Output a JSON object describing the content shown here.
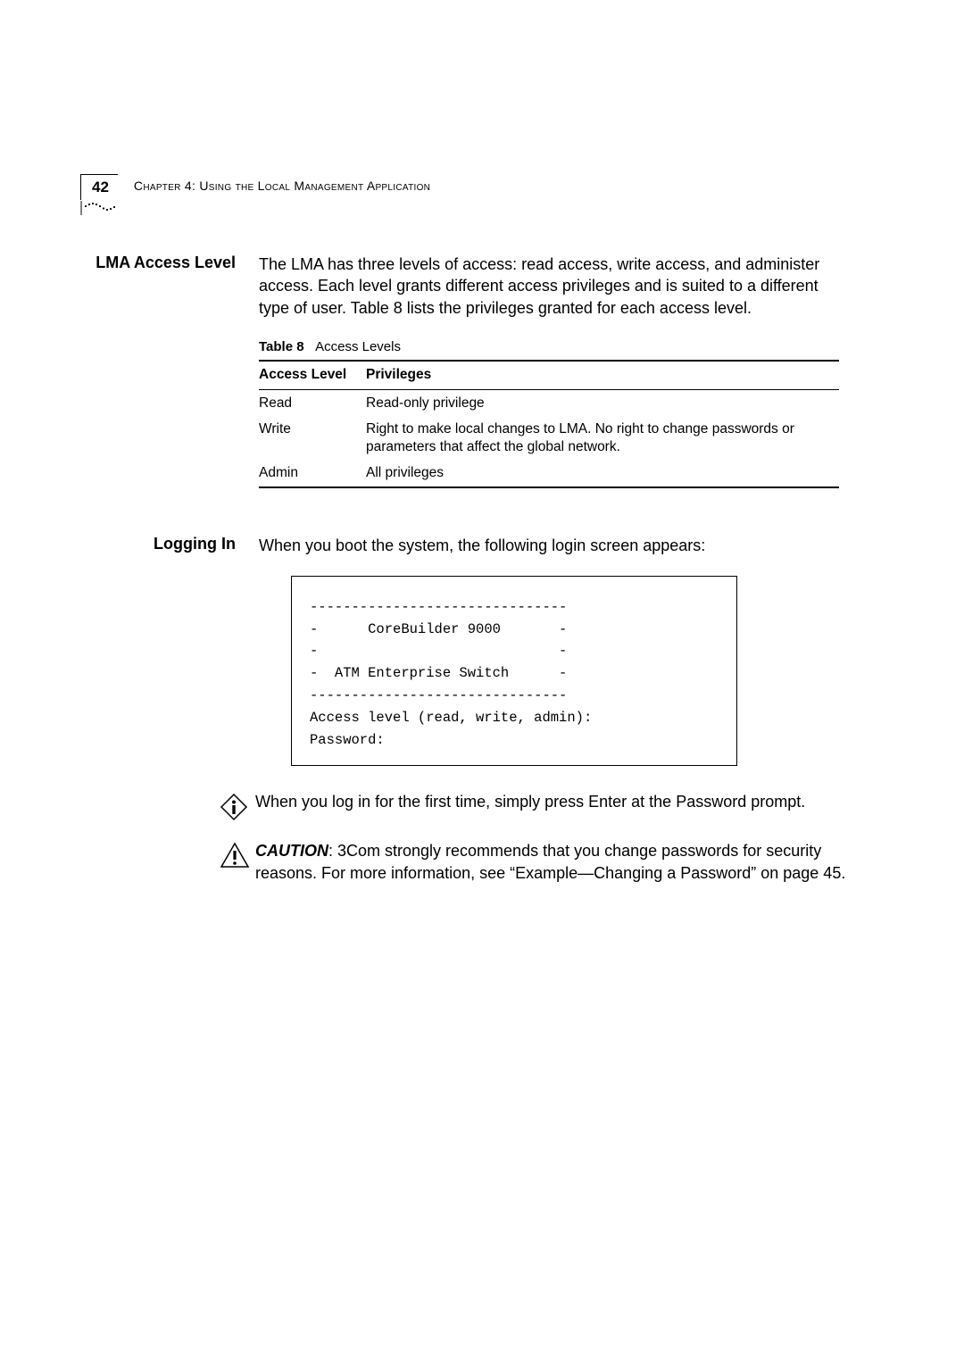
{
  "header": {
    "page_number": "42",
    "chapter_title": "Chapter 4: Using the Local Management Application"
  },
  "section_access": {
    "label": "LMA Access Level",
    "paragraph": "The LMA has three levels of access: read access, write access, and administer access. Each level grants different access privileges and is suited to a different type of user. Table 8 lists the privileges granted for each access level.",
    "table_caption_label": "Table 8",
    "table_caption_text": "Access Levels",
    "table": {
      "headers": {
        "col1": "Access Level",
        "col2": "Privileges"
      },
      "rows": [
        {
          "level": "Read",
          "priv": "Read-only privilege"
        },
        {
          "level": "Write",
          "priv": "Right to make local changes to LMA. No right to change passwords or parameters that affect the global network."
        },
        {
          "level": "Admin",
          "priv": "All privileges"
        }
      ]
    }
  },
  "section_logging": {
    "label": "Logging In",
    "paragraph": "When you boot the system, the following login screen appears:",
    "code": "-------------------------------\n-      CoreBuilder 9000       -\n-                             -\n-  ATM Enterprise Switch      -\n-------------------------------\nAccess level (read, write, admin):\nPassword:",
    "note_info": "When you log in for the first time, simply press Enter at the Password prompt.",
    "caution_label": "CAUTION",
    "caution_text": ": 3Com strongly recommends that you change passwords for security reasons. For more information, see “Example—Changing a Password” on page 45."
  }
}
